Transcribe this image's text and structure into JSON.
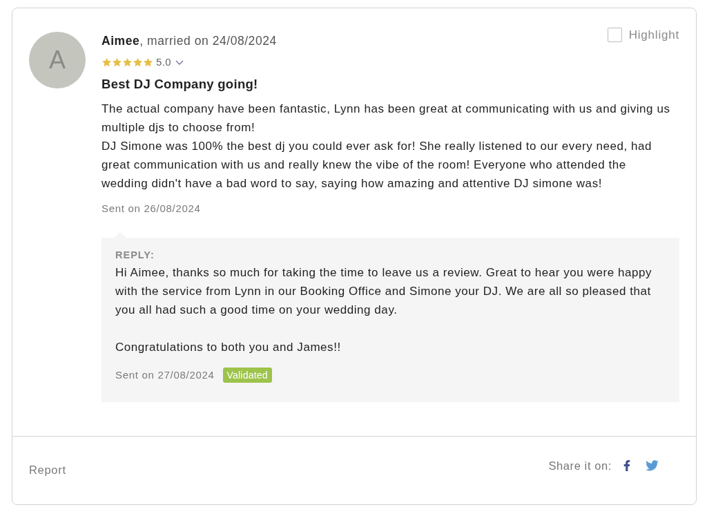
{
  "review": {
    "avatar_initial": "A",
    "reviewer_line": "**Aimee**, married on 24/08/2024",
    "rating": {
      "stars": 5,
      "value": "5.0"
    },
    "highlight": {
      "label": "Highlight",
      "checked": false
    },
    "title": "Best DJ Company going!",
    "body": [
      "The actual company have been fantastic, Lynn has been great at communicating with us and giving us multiple djs to choose from!",
      "DJ Simone was 100% the best dj you could ever ask for! She really listened to our every need, had great communication with us and really knew the vibe of the room! Everyone who attended the wedding didn't have a bad word to say, saying how amazing and attentive DJ simone was!"
    ],
    "sent_on": "Sent on 26/08/2024",
    "reply": {
      "heading": "REPLY:",
      "paragraphs": [
        "Hi Aimee, thanks so much for taking the time to leave us a review. Great to hear you were happy with the service from Lynn in our Booking Office and Simone your DJ. We are all so pleased that you all had such a good time on your wedding day.",
        "Congratulations to both you and James!!"
      ],
      "sent_on": "Sent on 27/08/2024",
      "badge": "Validated"
    }
  },
  "footer": {
    "report": "Report",
    "share_label": "Share it on:"
  }
}
